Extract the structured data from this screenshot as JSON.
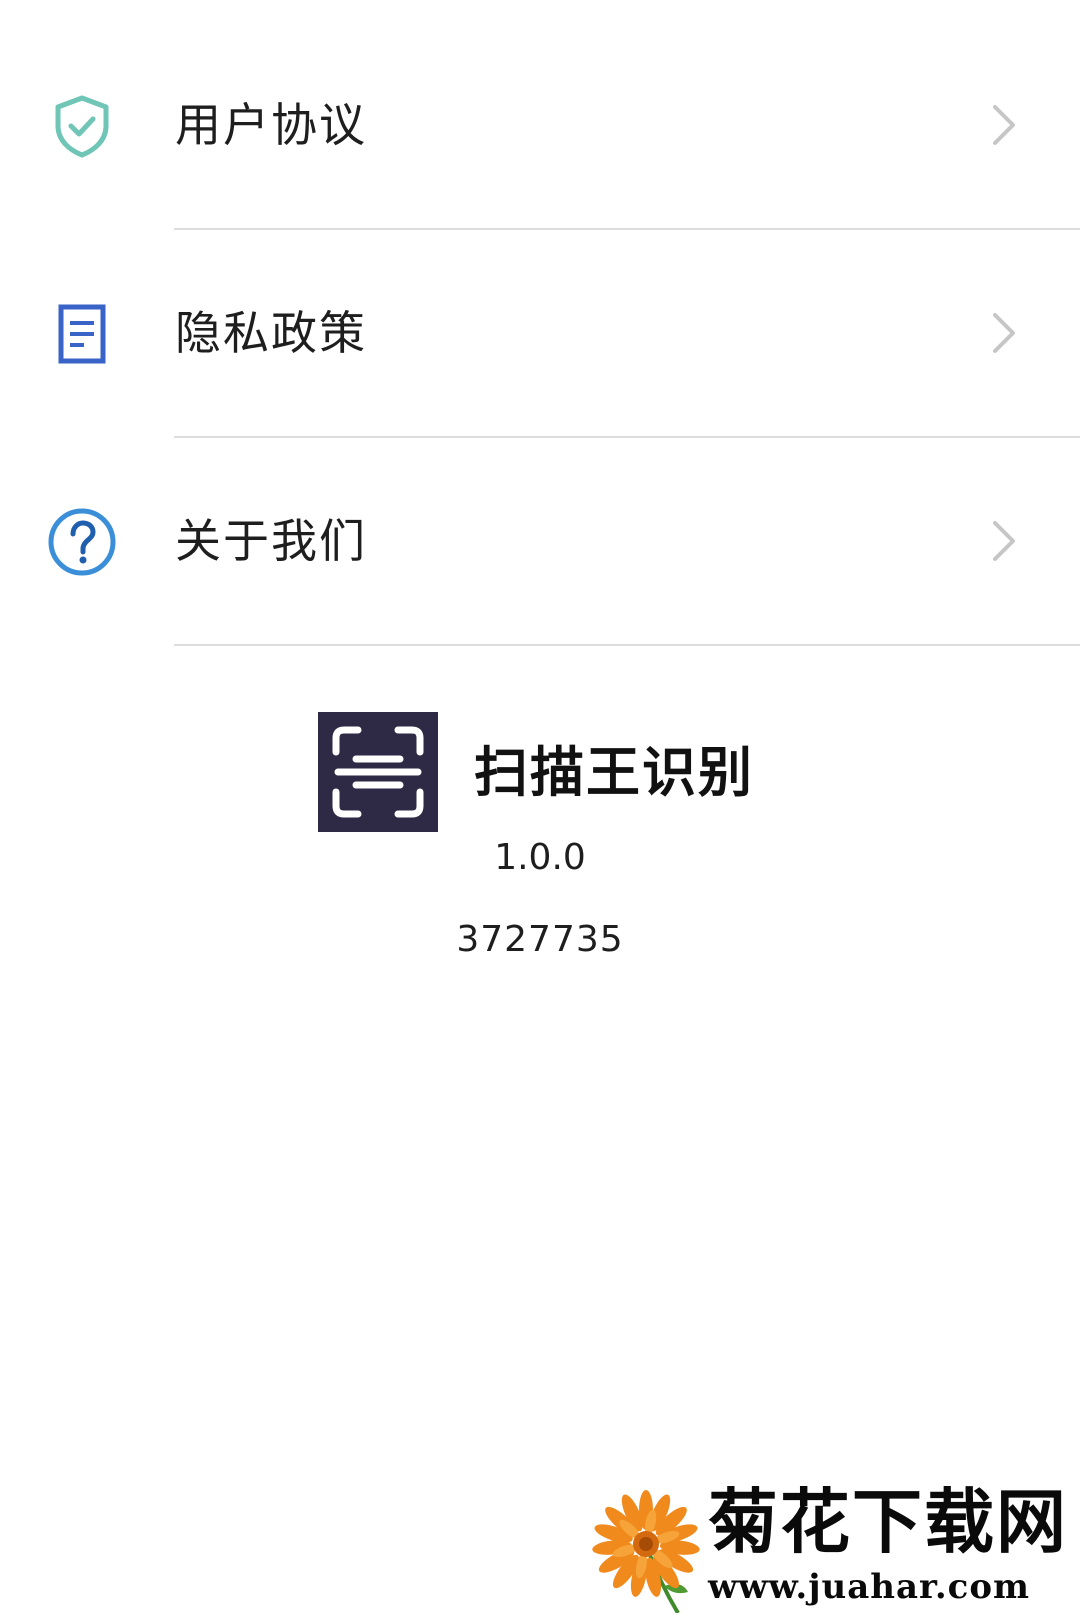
{
  "menu": {
    "items": [
      {
        "label": "用户协议",
        "icon": "shield-check-icon",
        "icon_color": "#6fc5b6"
      },
      {
        "label": "隐私政策",
        "icon": "document-icon",
        "icon_color": "#3a63c7"
      },
      {
        "label": "关于我们",
        "icon": "question-circle-icon",
        "icon_color": "#3b8ed8"
      }
    ],
    "chevron_icon": "chevron-right-icon",
    "chevron_color": "#c6c6c6",
    "divider_color": "#dcdcdc"
  },
  "app": {
    "logo_icon": "scan-frame-icon",
    "logo_bg": "#2e2945",
    "name": "扫描王识别",
    "version": "1.0.0",
    "build": "3727735"
  },
  "watermark": {
    "icon": "orange-flower-icon",
    "title": "菊花下载网",
    "url": "www.juahar.com"
  }
}
